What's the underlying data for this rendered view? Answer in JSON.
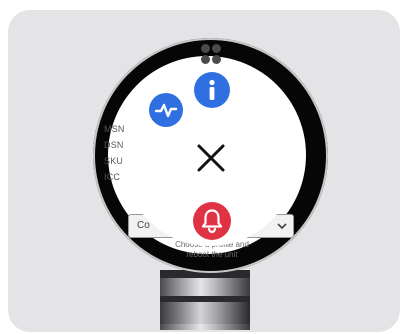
{
  "background_screen": {
    "labels": [
      "MSN",
      "DSN",
      "SKU",
      "ICC"
    ],
    "dropdown_value": "Co",
    "note_line1": "Choose a profile and",
    "note_line2": "reboot the unit"
  },
  "quick_menu": {
    "buttons": [
      {
        "name": "info",
        "icon": "info-icon",
        "color": "#2f6fe0"
      },
      {
        "name": "health",
        "icon": "pulse-icon",
        "color": "#2f6fe0"
      },
      {
        "name": "close",
        "icon": "close-icon",
        "color": "#111111"
      },
      {
        "name": "alarm",
        "icon": "bell-icon",
        "color": "#df3344"
      }
    ]
  },
  "colors": {
    "card_background": "#e4e4e6",
    "bezel": "#060606",
    "accent_blue": "#2f6fe0",
    "alert_red": "#df3344"
  }
}
